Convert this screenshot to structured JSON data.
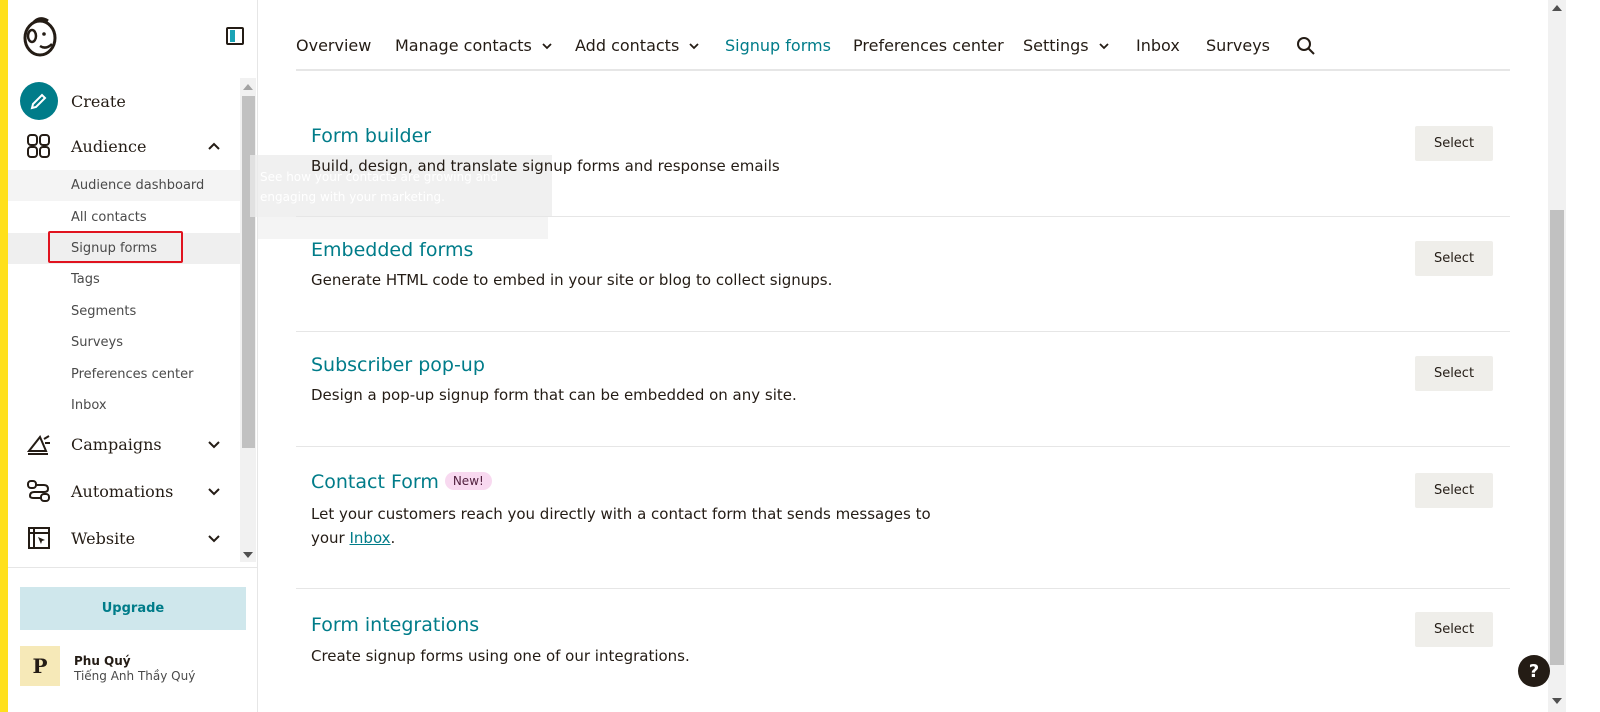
{
  "sidebar": {
    "nav": {
      "create": "Create",
      "audience": "Audience",
      "campaigns": "Campaigns",
      "automations": "Automations",
      "website": "Website"
    },
    "audience_items": [
      "Audience dashboard",
      "All contacts",
      "Signup forms",
      "Tags",
      "Segments",
      "Surveys",
      "Preferences center",
      "Inbox"
    ],
    "selected_item": "Signup forms",
    "tooltip_line1": "See how your contacts are growing and",
    "tooltip_line2": "engaging with your marketing.",
    "upgrade_label": "Upgrade",
    "account": {
      "avatar_letter": "P",
      "name": "Phu Quý",
      "org": "Tiếng Anh Thầy Quý"
    }
  },
  "tabs": [
    "Overview",
    "Manage contacts",
    "Add contacts",
    "Signup forms",
    "Preferences center",
    "Settings",
    "Inbox",
    "Surveys"
  ],
  "active_tab": "Signup forms",
  "forms": [
    {
      "title": "Form builder",
      "desc": "Build, design, and translate signup forms and response emails",
      "button": "Select"
    },
    {
      "title": "Embedded forms",
      "desc": "Generate HTML code to embed in your site or blog to collect signups.",
      "button": "Select"
    },
    {
      "title": "Subscriber pop-up",
      "desc": "Design a pop-up signup form that can be embedded on any site.",
      "button": "Select"
    },
    {
      "title": "Contact Form",
      "badge": "New!",
      "desc_line1": "Let your customers reach you directly with a contact form that sends messages to",
      "desc_line2_prefix": "your ",
      "desc_link": "Inbox",
      "desc_line2_suffix": ".",
      "button": "Select"
    },
    {
      "title": "Form integrations",
      "desc": "Create signup forms using one of our integrations.",
      "button": "Select"
    }
  ],
  "help_label": "?",
  "colors": {
    "accent": "#007c89",
    "brand_yellow": "#ffe01b",
    "selection_outline": "#e0131f"
  }
}
